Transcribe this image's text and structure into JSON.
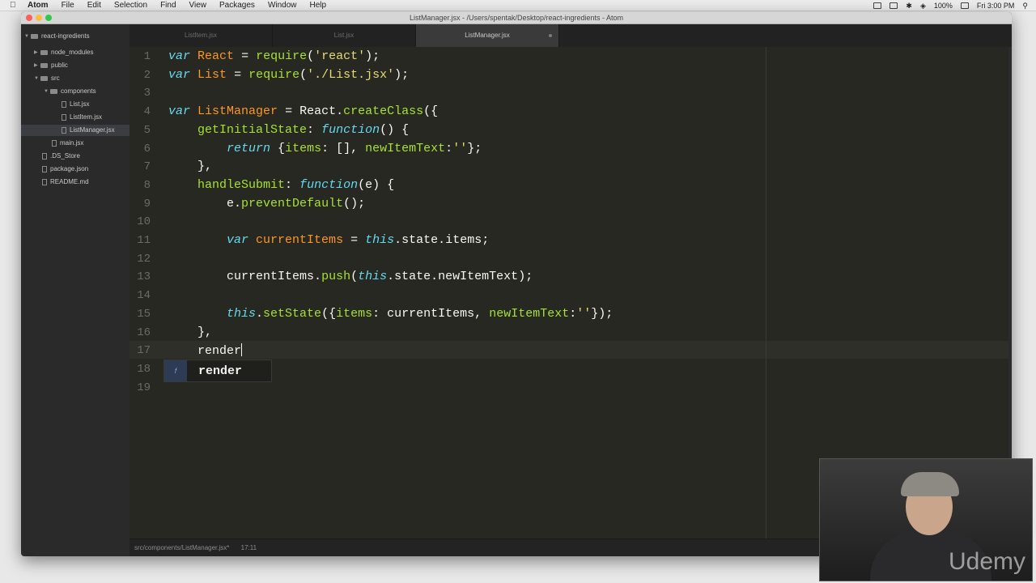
{
  "menubar": {
    "app": "Atom",
    "items": [
      "File",
      "Edit",
      "Selection",
      "Find",
      "View",
      "Packages",
      "Window",
      "Help"
    ],
    "battery": "100%",
    "clock": "Fri 3:00 PM"
  },
  "window": {
    "title": "ListManager.jsx - /Users/spentak/Desktop/react-ingredients - Atom"
  },
  "tree": {
    "root": "react-ingredients",
    "items": [
      {
        "label": "node_modules"
      },
      {
        "label": "public"
      },
      {
        "label": "src"
      },
      {
        "label": "components"
      },
      {
        "label": "List.jsx"
      },
      {
        "label": "ListItem.jsx"
      },
      {
        "label": "ListManager.jsx"
      },
      {
        "label": "main.jsx"
      },
      {
        "label": ".DS_Store"
      },
      {
        "label": "package.json"
      },
      {
        "label": "README.md"
      }
    ]
  },
  "tabs": [
    {
      "label": "ListItem.jsx"
    },
    {
      "label": "List.jsx"
    },
    {
      "label": "ListManager.jsx"
    }
  ],
  "editor": {
    "line_numbers": [
      "1",
      "2",
      "3",
      "4",
      "5",
      "6",
      "7",
      "8",
      "9",
      "10",
      "11",
      "12",
      "13",
      "14",
      "15",
      "16",
      "17",
      "18",
      "19"
    ],
    "lines": [
      "var React = require('react');",
      "var List = require('./List.jsx');",
      "",
      "var ListManager = React.createClass({",
      "    getInitialState: function() {",
      "        return {items: [], newItemText:''};",
      "    },",
      "    handleSubmit: function(e) {",
      "        e.preventDefault();",
      "",
      "        var currentItems = this.state.items;",
      "",
      "        currentItems.push(this.state.newItemText);",
      "",
      "        this.setState({items: currentItems, newItemText:''});",
      "    },",
      "    render",
      "",
      ""
    ],
    "autocomplete": {
      "type_glyph": "f",
      "suggestion": "render"
    }
  },
  "status": {
    "path": "src/components/ListManager.jsx*",
    "cursor": "17:11"
  },
  "watermark": "Udemy",
  "colors": {
    "editor_bg": "#272822",
    "keyword": "#66d9ef",
    "string": "#e6db74",
    "function": "#a6e22e",
    "variable": "#fd971f"
  }
}
